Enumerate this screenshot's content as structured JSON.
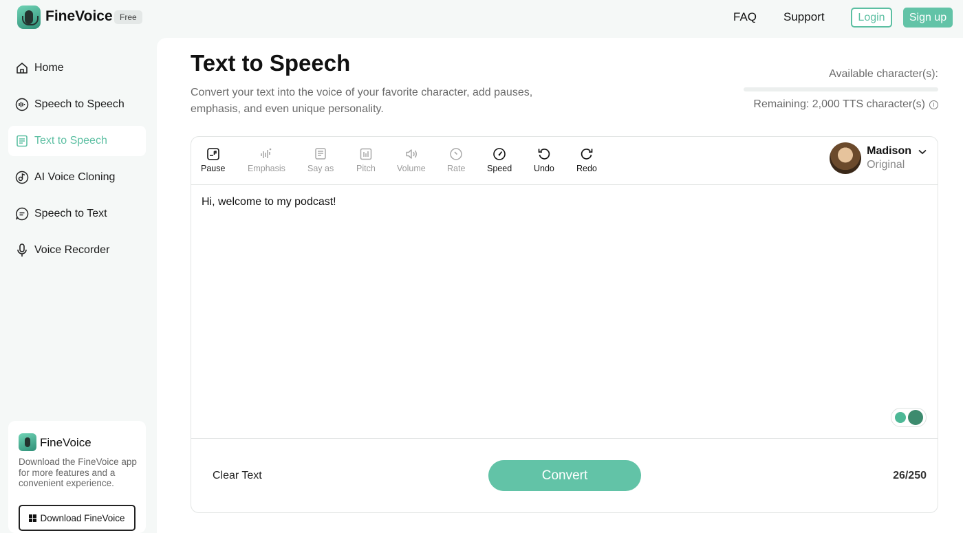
{
  "header": {
    "brand": "FineVoice",
    "badge": "Free",
    "nav": {
      "faq": "FAQ",
      "support": "Support"
    },
    "login": "Login",
    "signup": "Sign up"
  },
  "sidebar": {
    "items": [
      {
        "label": "Home",
        "icon": "home-icon"
      },
      {
        "label": "Speech to Speech",
        "icon": "waveform-icon"
      },
      {
        "label": "Text to Speech",
        "icon": "document-icon",
        "active": true
      },
      {
        "label": "AI Voice Cloning",
        "icon": "clone-icon"
      },
      {
        "label": "Speech to Text",
        "icon": "chat-text-icon"
      },
      {
        "label": "Voice Recorder",
        "icon": "mic-icon"
      }
    ],
    "promo": {
      "brand": "FineVoice",
      "description": "Download the FineVoice app for more features and a convenient experience.",
      "button": "Download FineVoice"
    }
  },
  "main": {
    "title": "Text to Speech",
    "subtitle": "Convert your text into the voice of your favorite character, add pauses, emphasis, and even unique personality.",
    "available_label": "Available character(s):",
    "usage_fraction": 0.0,
    "remaining": "Remaining: 2,000 TTS character(s)",
    "toolbar": [
      {
        "label": "Pause",
        "enabled": true
      },
      {
        "label": "Emphasis",
        "enabled": false
      },
      {
        "label": "Say as",
        "enabled": false
      },
      {
        "label": "Pitch",
        "enabled": false
      },
      {
        "label": "Volume",
        "enabled": false
      },
      {
        "label": "Rate",
        "enabled": false
      },
      {
        "label": "Speed",
        "enabled": true
      },
      {
        "label": "Undo",
        "enabled": true
      },
      {
        "label": "Redo",
        "enabled": true
      }
    ],
    "voice": {
      "name": "Madison",
      "style": "Original"
    },
    "text": "Hi, welcome to my podcast!",
    "clear": "Clear Text",
    "convert": "Convert",
    "count": "26/250"
  },
  "colors": {
    "accent": "#62c3a7"
  }
}
